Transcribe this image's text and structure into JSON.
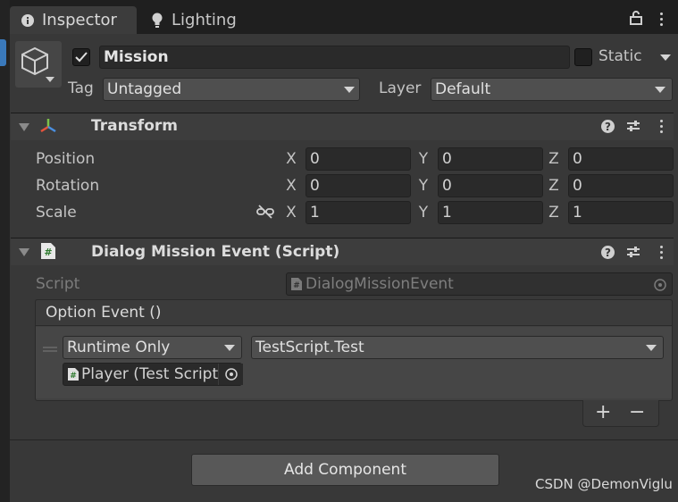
{
  "tabs": [
    {
      "label": "Inspector",
      "icon": "info-icon"
    },
    {
      "label": "Lighting",
      "icon": "lightbulb-icon"
    }
  ],
  "header": {
    "object_name": "Mission",
    "active": true,
    "static_label": "Static",
    "static_checked": false,
    "tag_label": "Tag",
    "tag_value": "Untagged",
    "layer_label": "Layer",
    "layer_value": "Default"
  },
  "transform": {
    "title": "Transform",
    "position": {
      "label": "Position",
      "x": "0",
      "y": "0",
      "z": "0"
    },
    "rotation": {
      "label": "Rotation",
      "x": "0",
      "y": "0",
      "z": "0"
    },
    "scale": {
      "label": "Scale",
      "x": "1",
      "y": "1",
      "z": "1"
    },
    "axes": {
      "x": "X",
      "y": "Y",
      "z": "Z"
    }
  },
  "script_component": {
    "title": "Dialog Mission Event (Script)",
    "script_label": "Script",
    "script_value": "DialogMissionEvent",
    "event": {
      "title": "Option Event ()",
      "runtime_mode": "Runtime Only",
      "function": "TestScript.Test",
      "target": "Player (Test Script)",
      "add_symbol": "+",
      "remove_symbol": "−"
    }
  },
  "footer": {
    "add_component_label": "Add Component",
    "watermark": "CSDN @DemonViglu"
  },
  "colors": {
    "panel_bg": "#383838",
    "field_bg": "#2a2a2a",
    "accent_blue": "#3a79bb"
  }
}
